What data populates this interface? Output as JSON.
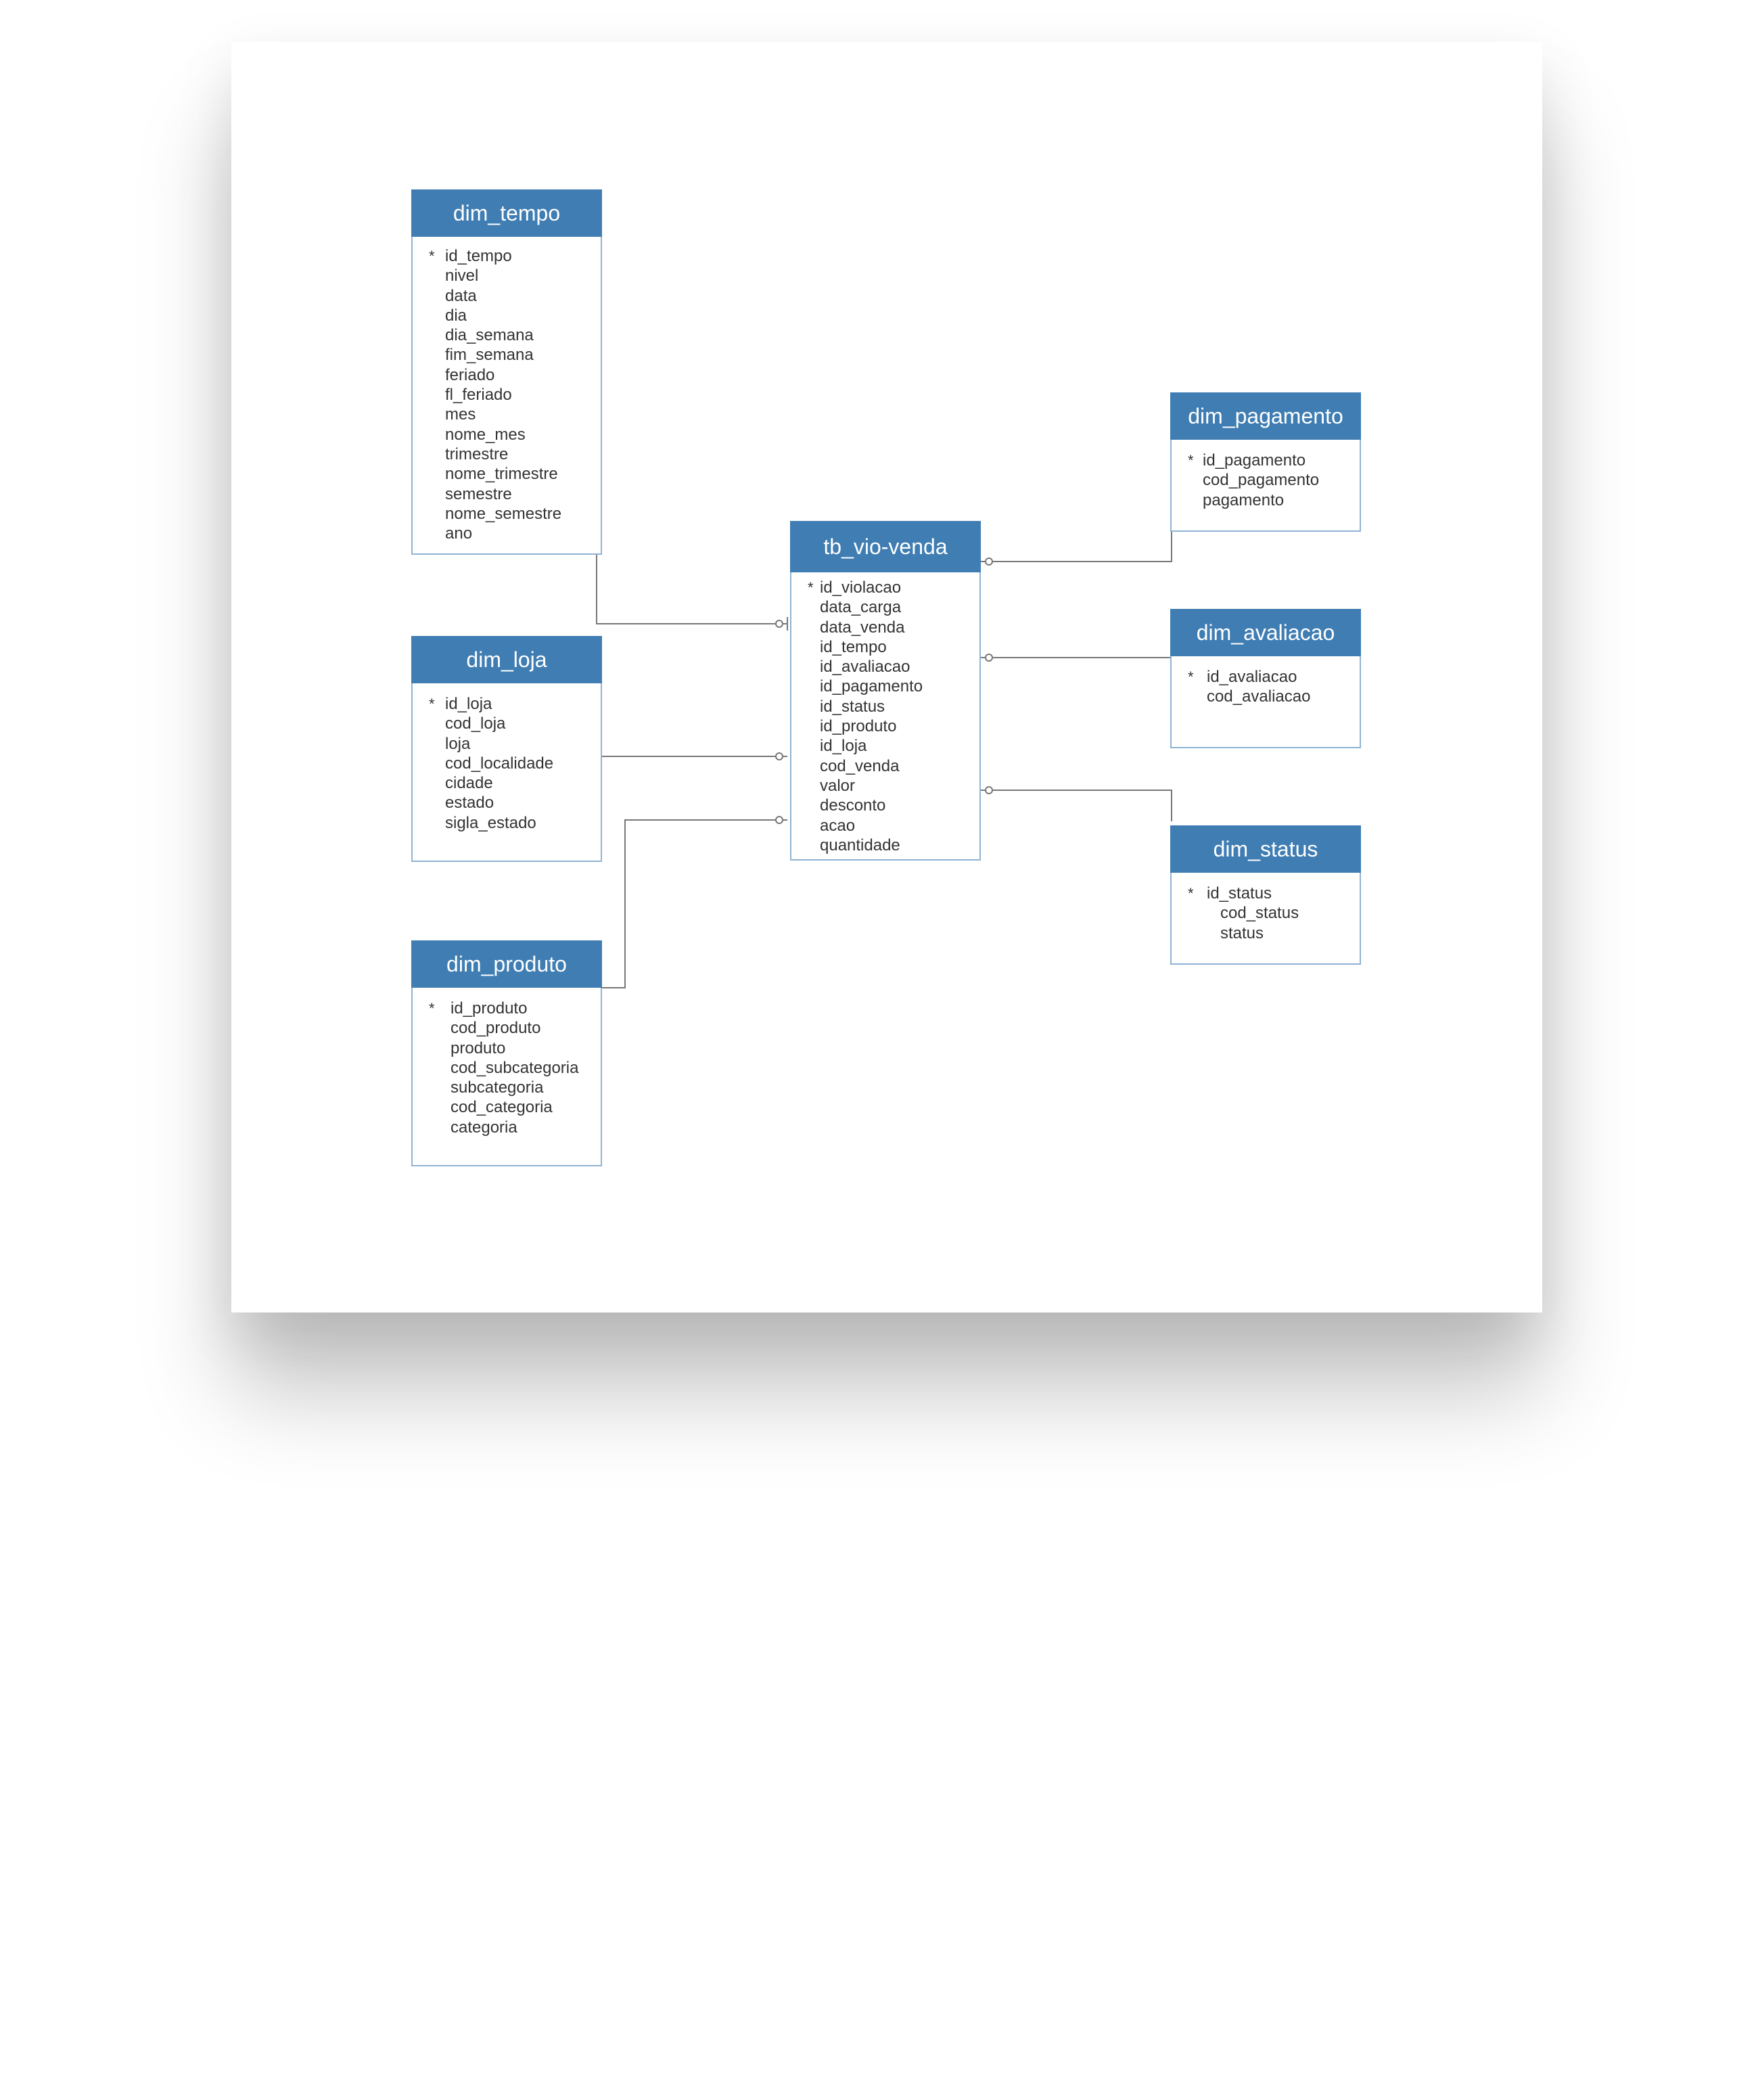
{
  "entities": {
    "dim_tempo": {
      "title": "dim_tempo",
      "pk_marker": "*",
      "attributes": [
        "id_tempo",
        "nivel",
        "data",
        "dia",
        "dia_semana",
        "fim_semana",
        "feriado",
        "fl_feriado",
        "mes",
        "nome_mes",
        "trimestre",
        "nome_trimestre",
        "semestre",
        "nome_semestre",
        "ano"
      ]
    },
    "dim_loja": {
      "title": "dim_loja",
      "pk_marker": "*",
      "attributes": [
        "id_loja",
        "cod_loja",
        "loja",
        "cod_localidade",
        "cidade",
        "estado",
        "sigla_estado"
      ]
    },
    "dim_produto": {
      "title": "dim_produto",
      "pk_marker": "*",
      "attributes": [
        "id_produto",
        "cod_produto",
        "produto",
        "cod_subcategoria",
        "subcategoria",
        "cod_categoria",
        "categoria"
      ]
    },
    "tb_vio_venda": {
      "title": "tb_vio-venda",
      "pk_marker": "*",
      "attributes": [
        "id_violacao",
        "data_carga",
        "data_venda",
        "id_tempo",
        "id_avaliacao",
        "id_pagamento",
        "id_status",
        "id_produto",
        "id_loja",
        "cod_venda",
        "valor",
        "desconto",
        "acao",
        "quantidade"
      ]
    },
    "dim_pagamento": {
      "title": "dim_pagamento",
      "pk_marker": "*",
      "attributes": [
        "id_pagamento",
        "cod_pagamento",
        "pagamento"
      ]
    },
    "dim_avaliacao": {
      "title": "dim_avaliacao",
      "pk_marker": "*",
      "attributes": [
        "id_avaliacao",
        "cod_avaliacao"
      ]
    },
    "dim_status": {
      "title": "dim_status",
      "pk_marker": "*",
      "attributes": [
        "id_status",
        "cod_status",
        "status"
      ]
    }
  },
  "relationships": [
    {
      "from": "dim_tempo",
      "to": "tb_vio_venda",
      "cardinality": "zero-or-many"
    },
    {
      "from": "dim_loja",
      "to": "tb_vio_venda",
      "cardinality": "zero-or-many"
    },
    {
      "from": "dim_produto",
      "to": "tb_vio_venda",
      "cardinality": "zero-or-many"
    },
    {
      "from": "dim_pagamento",
      "to": "tb_vio_venda",
      "cardinality": "zero-or-many"
    },
    {
      "from": "dim_avaliacao",
      "to": "tb_vio_venda",
      "cardinality": "zero-or-many"
    },
    {
      "from": "dim_status",
      "to": "tb_vio_venda",
      "cardinality": "zero-or-many"
    }
  ],
  "colors": {
    "header": "#3f7db3",
    "border": "#8fb3d4",
    "line": "#777777"
  }
}
